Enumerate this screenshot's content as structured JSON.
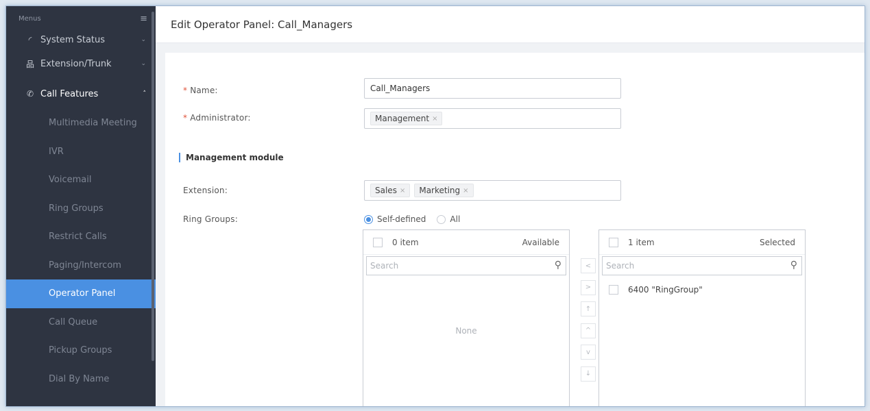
{
  "sidebar": {
    "menus_label": "Menus",
    "top_items": [
      {
        "label": "System Status",
        "icon": "gauge-icon"
      },
      {
        "label": "Extension/Trunk",
        "icon": "network-icon"
      },
      {
        "label": "Call Features",
        "icon": "phone-icon"
      }
    ],
    "sub_items": [
      "Multimedia Meeting",
      "IVR",
      "Voicemail",
      "Ring Groups",
      "Restrict Calls",
      "Paging/Intercom",
      "Operator Panel",
      "Call Queue",
      "Pickup Groups",
      "Dial By Name"
    ],
    "selected_sub_item": "Operator Panel"
  },
  "header": {
    "title": "Edit Operator Panel: Call_Managers"
  },
  "form": {
    "name_label": "Name:",
    "name_value": "Call_Managers",
    "admin_label": "Administrator:",
    "admin_tags": [
      "Management"
    ],
    "section_title": "Management module",
    "extension_label": "Extension:",
    "extension_tags": [
      "Sales",
      "Marketing"
    ],
    "ring_groups_label": "Ring Groups:",
    "radio_self": "Self-defined",
    "radio_all": "All",
    "radio_selected": "Self-defined"
  },
  "transfer": {
    "left": {
      "count": "0 item",
      "title": "Available",
      "search_placeholder": "Search",
      "empty_text": "None",
      "items": []
    },
    "right": {
      "count": "1 item",
      "title": "Selected",
      "search_placeholder": "Search",
      "items": [
        "6400 \"RingGroup\""
      ]
    },
    "controls": [
      "<",
      ">",
      "↑",
      "^",
      "v",
      "↓"
    ]
  },
  "colors": {
    "accent": "#4a90e2",
    "sidebar_bg": "#2e3441",
    "required": "#e0533b"
  }
}
